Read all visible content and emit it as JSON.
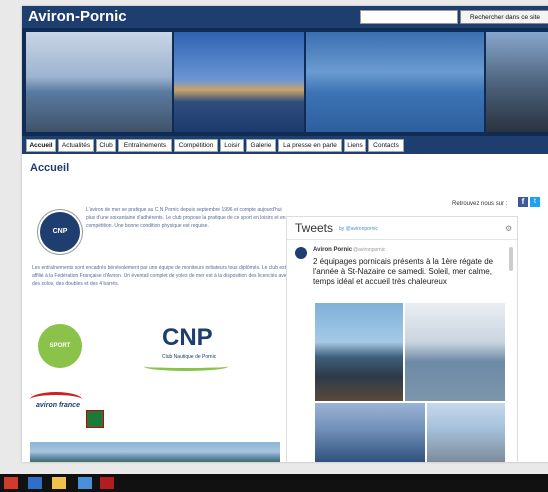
{
  "site": {
    "title": "Aviron-Pornic",
    "search_placeholder": "",
    "search_button": "Rechercher dans ce site"
  },
  "nav": [
    {
      "label": "Accueil"
    },
    {
      "label": "Actualités"
    },
    {
      "label": "Club"
    },
    {
      "label": "Entraînements"
    },
    {
      "label": "Compétition"
    },
    {
      "label": "Loisir"
    },
    {
      "label": "Galerie"
    },
    {
      "label": "La presse en parle"
    },
    {
      "label": "Liens"
    },
    {
      "label": "Contacts"
    }
  ],
  "page": {
    "title": "Accueil",
    "social_label": "Retrouvez nous sur :",
    "intro": "L'aviron de mer se pratique au C.N.Pornic depuis septembre 1996 et compte aujourd'hui plus d'une soixantaine d'adhérents. Le club propose la pratique de ce sport en loisirs et en compétition. Une bonne condition physique est requise.",
    "body": "Les entraînements sont encadrés bénévolement par une équipe de moniteurs initiateurs tous diplômés. Le club est affilié à la Fédération Française d'Aviron. Un éventail complet de yoles de mer est à la disposition des licenciés avec des solos, des doubles et des 4 barrés.",
    "cnp_sub": "Club Nautique de Pornic",
    "ffa_text": "aviron france"
  },
  "twitter": {
    "header": "Tweets",
    "by": "by @avironpornic",
    "author": "Aviron Pornic",
    "handle": "@avironpornic",
    "text": "2 équipages pornicais présents à la 1ère régate de l'année à St-Nazaire ce samedi. Soleil, mer calme, temps idéal et accueil très chaleureux"
  },
  "colors": {
    "brand_navy": "#1d3e6e",
    "facebook": "#3b5998",
    "twitter": "#1da1f2"
  }
}
